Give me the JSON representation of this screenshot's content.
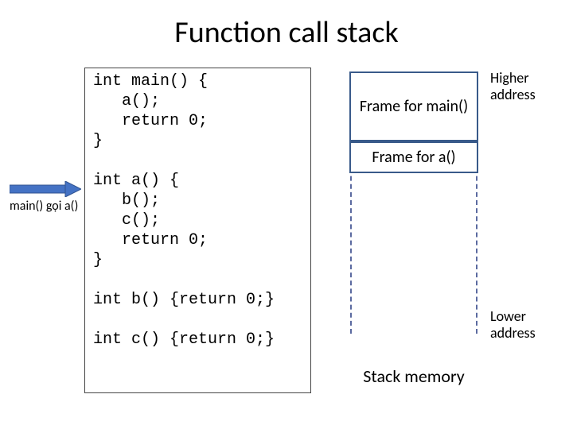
{
  "title": "Function call stack",
  "code": "int main() {\n   a();\n   return 0;\n}\n\nint a() {\n   b();\n   c();\n   return 0;\n}\n\nint b() {return 0;}\n\nint c() {return 0;}",
  "frames": {
    "main": "Frame for main()",
    "a": "Frame for a()"
  },
  "labels": {
    "higher": "Higher address",
    "lower": "Lower address",
    "stack_memory": "Stack memory"
  },
  "callout": "main() gọi a()"
}
